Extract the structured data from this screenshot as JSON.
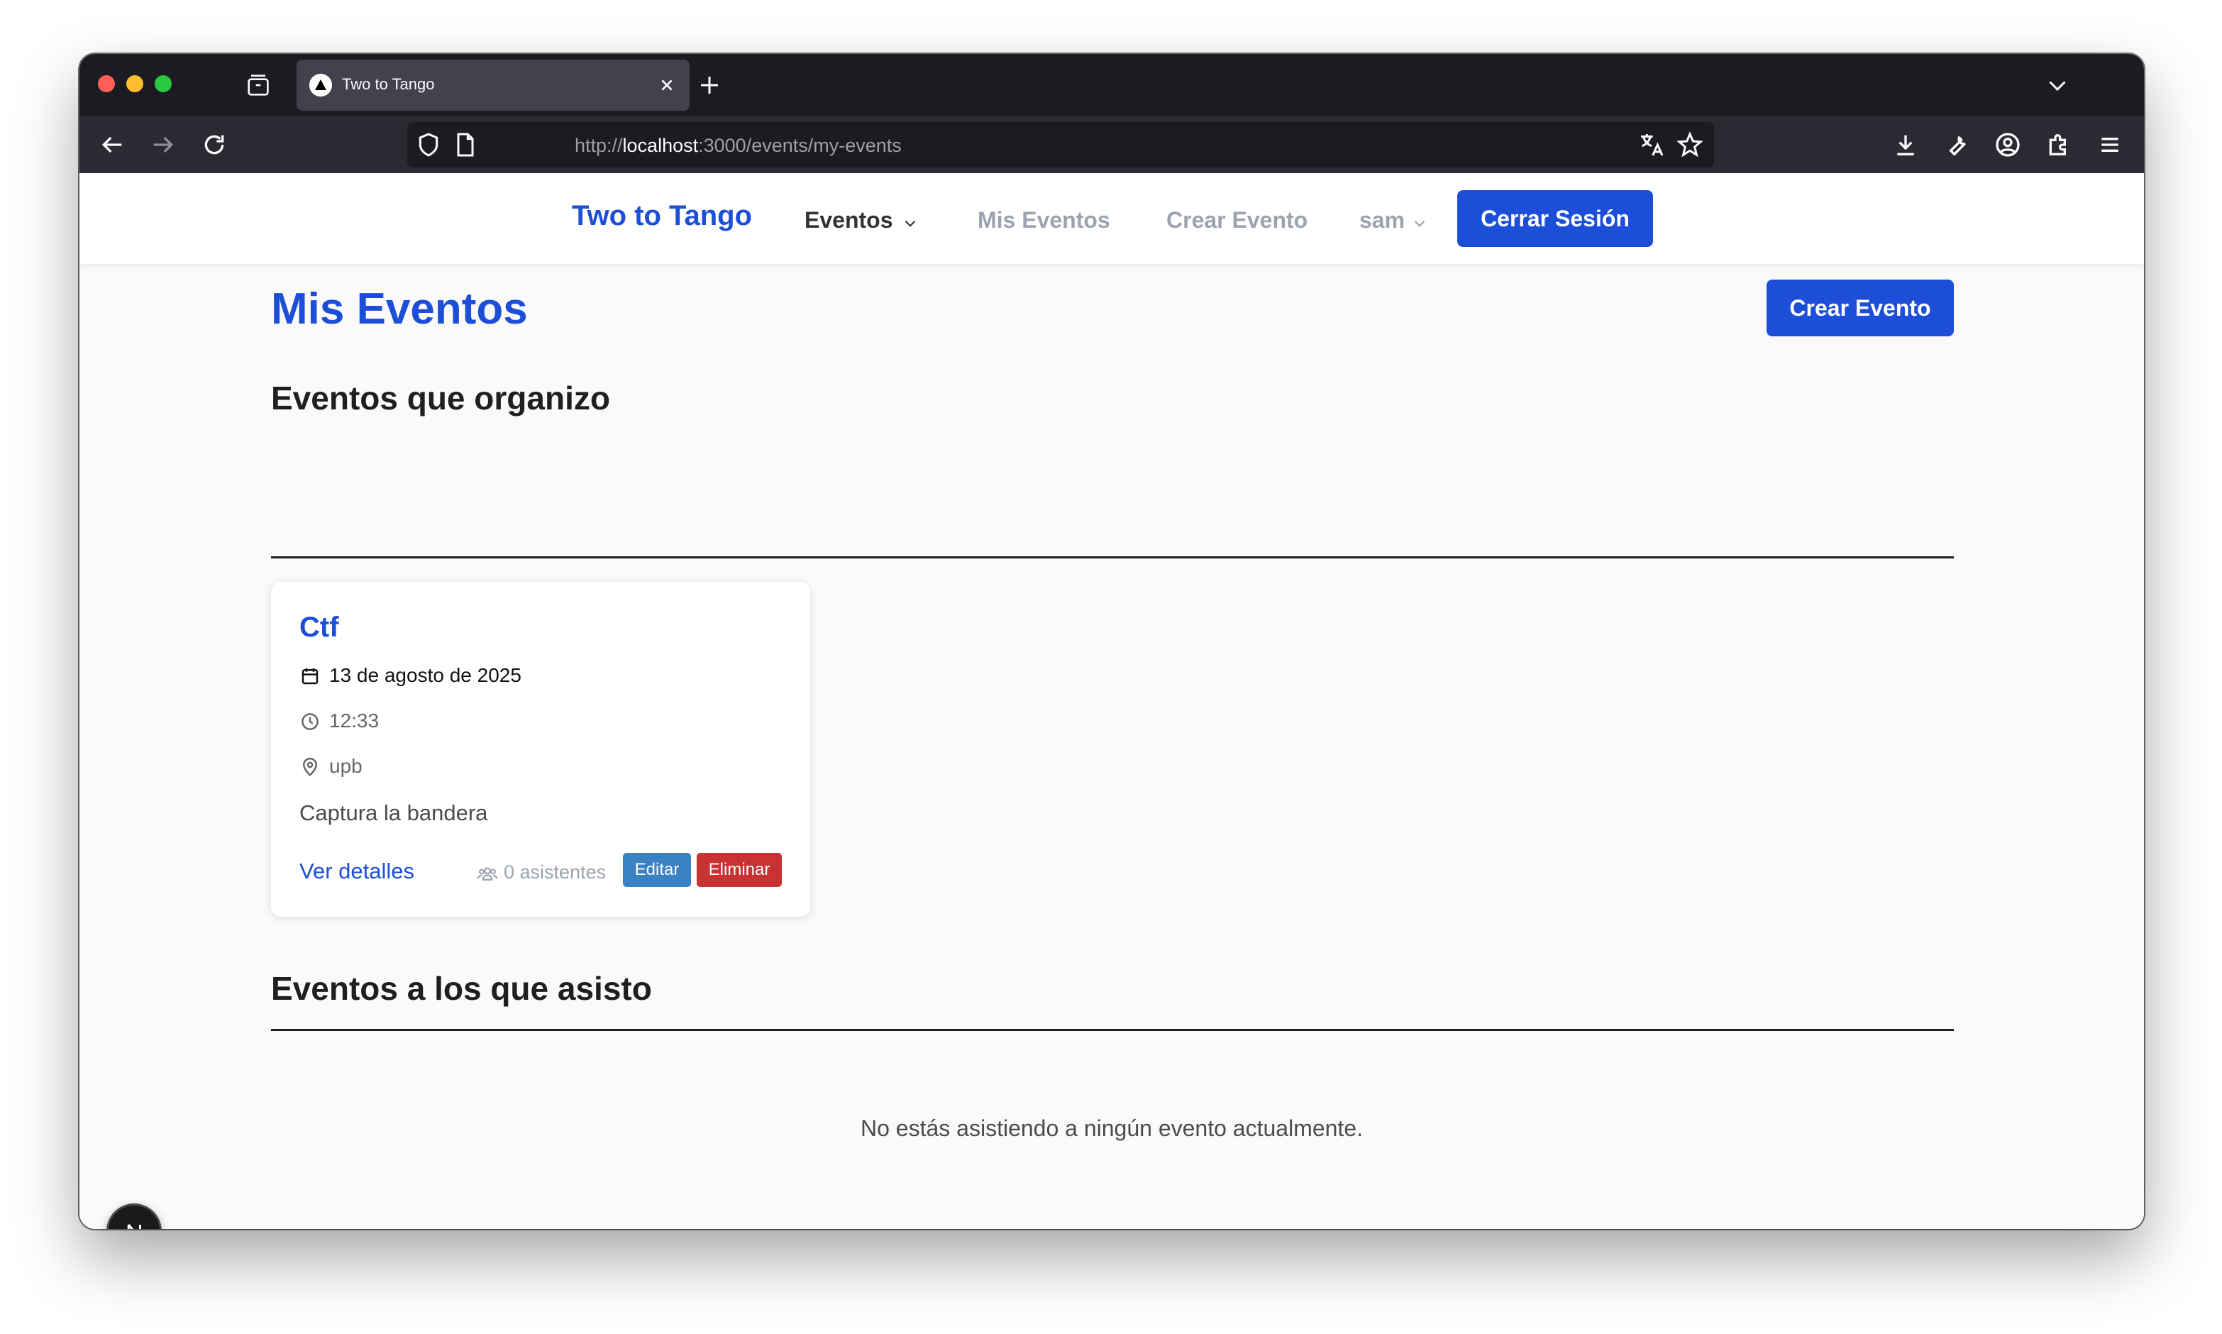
{
  "browser": {
    "tab": {
      "title": "Two to Tango",
      "favicon": "nextjs-triangle-icon"
    },
    "url": {
      "scheme": "http://",
      "host": "localhost",
      "rest": ":3000/events/my-events"
    }
  },
  "nav": {
    "brand": "Two to Tango",
    "links": {
      "eventos": "Eventos",
      "mis_eventos": "Mis Eventos",
      "crear_evento": "Crear Evento"
    },
    "user": "sam",
    "logout": "Cerrar Sesión"
  },
  "main": {
    "title": "Mis Eventos",
    "create_button": "Crear Evento",
    "organized": {
      "heading": "Eventos que organizo",
      "events": [
        {
          "title": "Ctf",
          "date": "13 de agosto de 2025",
          "time": "12:33",
          "location": "upb",
          "description": "Captura la bandera",
          "details_link": "Ver detalles",
          "attendees": "0 asistentes",
          "edit": "Editar",
          "delete": "Eliminar"
        }
      ]
    },
    "attending": {
      "heading": "Eventos a los que asisto",
      "empty": "No estás asistiendo a ningún evento actualmente."
    }
  },
  "colors": {
    "accent": "#1d4ed8",
    "edit": "#3b82c4",
    "delete": "#c83232"
  },
  "dev_badge": {
    "letter": "N"
  }
}
